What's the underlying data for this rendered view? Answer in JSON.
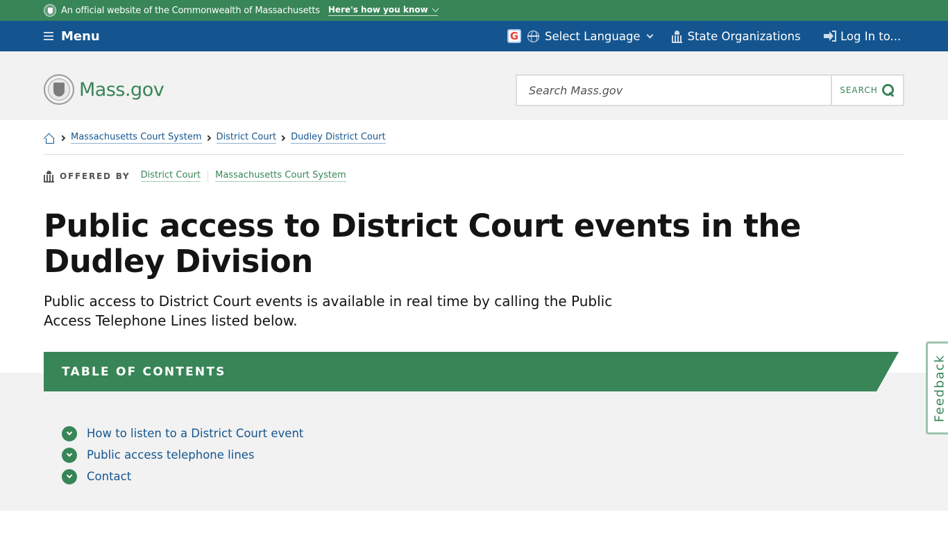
{
  "official_banner": {
    "text": "An official website of the Commonwealth of Massachusetts",
    "toggle_label": "Here's how you know"
  },
  "utility_nav": {
    "menu_label": "Menu",
    "language_label": "Select Language",
    "state_orgs_label": "State Organizations",
    "login_label": "Log In to..."
  },
  "header": {
    "logo_text": "Mass.gov",
    "search_placeholder": "Search Mass.gov",
    "search_button_label": "SEARCH"
  },
  "breadcrumb": {
    "items": [
      {
        "label": "Massachusetts Court System"
      },
      {
        "label": "District Court"
      },
      {
        "label": "Dudley District Court"
      }
    ]
  },
  "offered_by": {
    "label": "OFFERED BY",
    "orgs": [
      {
        "label": "District Court"
      },
      {
        "label": "Massachusetts Court System"
      }
    ]
  },
  "page": {
    "title": "Public access to District Court events in the Dudley Division",
    "lede": "Public access to District Court events is available in real time by calling the Public Access Telephone Lines listed below."
  },
  "toc": {
    "heading": "TABLE OF CONTENTS",
    "items": [
      {
        "label": "How to listen to a District Court event"
      },
      {
        "label": "Public access telephone lines"
      },
      {
        "label": "Contact"
      }
    ]
  },
  "feedback": {
    "label": "Feedback"
  },
  "colors": {
    "brand_green": "#388557",
    "nav_blue": "#14558f",
    "link_blue": "#14558f",
    "header_gray": "#f2f2f2"
  }
}
